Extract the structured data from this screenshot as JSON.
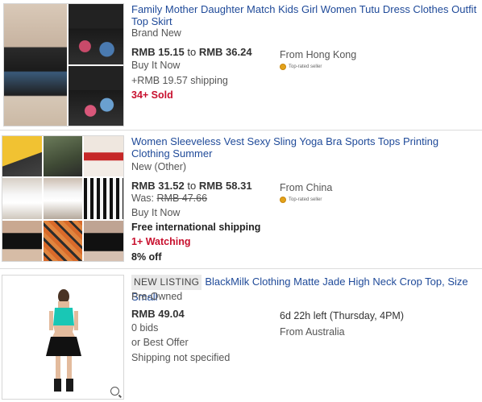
{
  "listings": [
    {
      "title": "Family Mother Daughter Match Kids Girl Women Tutu Dress Clothes Outfit Top Skirt",
      "condition": "Brand New",
      "price_low": "RMB 15.15",
      "price_sep": "to",
      "price_high": "RMB 36.24",
      "format": "Buy It Now",
      "shipping": "+RMB 19.57 shipping",
      "sold": "34+ Sold",
      "location": "From Hong Kong",
      "seller_badge": "Top-rated seller"
    },
    {
      "title": "Women Sleeveless Vest Sexy Sling Yoga Bra Sports Tops Printing Clothing Summer",
      "condition": "New (Other)",
      "price_low": "RMB 31.52",
      "price_sep": "to",
      "price_high": "RMB 58.31",
      "was_label": "Was:",
      "was_price": "RMB 47.66",
      "format": "Buy It Now",
      "shipping": "Free international shipping",
      "watching": "1+ Watching",
      "discount": "8% off",
      "location": "From China",
      "seller_badge": "Top-rated seller"
    },
    {
      "new_badge": "NEW LISTING",
      "title": "BlackMilk Clothing Matte Jade High Neck Crop Top, Size Small",
      "condition": "Pre-Owned",
      "price": "RMB 49.04",
      "bids": "0 bids",
      "best_offer": "or Best Offer",
      "shipping": "Shipping not specified",
      "time_left": "6d 22h left (Thursday, 4PM)",
      "location": "From Australia"
    }
  ],
  "colors": {
    "title_link": "#1f4a99",
    "alert_red": "#c8102e",
    "divider": "#dcdcdc",
    "badge_gold": "#e3a21a"
  },
  "icons": {
    "zoom": "magnifier-icon",
    "top_rated": "ribbon-icon"
  }
}
